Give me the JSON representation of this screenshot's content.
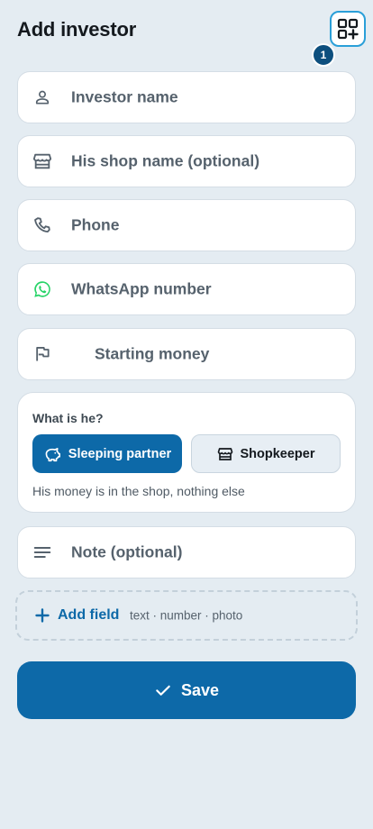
{
  "header": {
    "title": "Add investor",
    "scan_icon": "qr-add-icon",
    "badge_count": "1"
  },
  "form": {
    "investor_name": {
      "placeholder": "Investor name",
      "icon": "person-icon"
    },
    "shop_name": {
      "placeholder": "His shop name (optional)",
      "icon": "store-icon"
    },
    "phone": {
      "placeholder": "Phone",
      "icon": "phone-icon"
    },
    "whatsapp": {
      "placeholder": "WhatsApp number",
      "icon": "whatsapp-icon"
    },
    "starting_money": {
      "placeholder": "Starting money",
      "icon": "flag-icon"
    },
    "note": {
      "placeholder": "Note (optional)",
      "icon": "notes-icon"
    }
  },
  "role": {
    "question": "What is he?",
    "options": [
      {
        "label": "Sleeping partner",
        "icon": "piggy-bank-icon",
        "selected": true
      },
      {
        "label": "Shopkeeper",
        "icon": "store-icon",
        "selected": false
      }
    ],
    "help": "His money is in the shop, nothing else"
  },
  "add_field": {
    "label": "Add field",
    "hint": "text · number · photo"
  },
  "save": {
    "label": "Save",
    "icon": "check-icon"
  },
  "colors": {
    "background": "#e4ecf2",
    "primary": "#0d69a8",
    "badge": "#0d4f7e",
    "scan_border": "#2a9fd8",
    "whatsapp": "#25d366",
    "placeholder": "#56626d"
  }
}
